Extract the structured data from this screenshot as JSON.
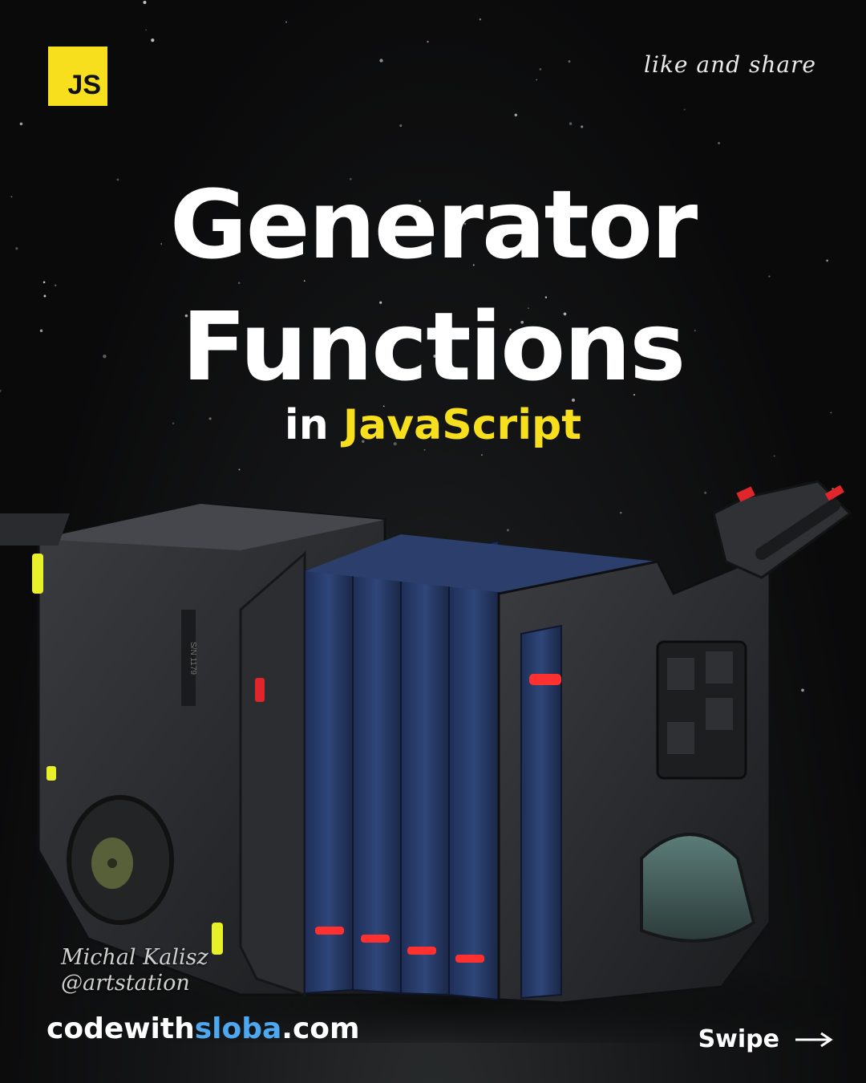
{
  "badge": {
    "label": "JS",
    "color": "#f7df1e"
  },
  "header": {
    "cta": "like and share"
  },
  "hero": {
    "title_line1": "Generator",
    "title_line2": "Functions",
    "subtitle_prefix": "in",
    "subtitle_highlight": "JavaScript",
    "highlight_color": "#f7df1e"
  },
  "credit": {
    "line1": "Michal Kalisz",
    "line2": "@artstation"
  },
  "footer": {
    "site_prefix": "codewith",
    "site_brand": "sloba",
    "site_suffix": ".com",
    "brand_color": "#4da8f0",
    "swipe_label": "Swipe",
    "swipe_icon": "arrow-right-icon"
  },
  "illustration": {
    "subject": "sci-fi cart machine",
    "label_text": "S/N 1179"
  }
}
